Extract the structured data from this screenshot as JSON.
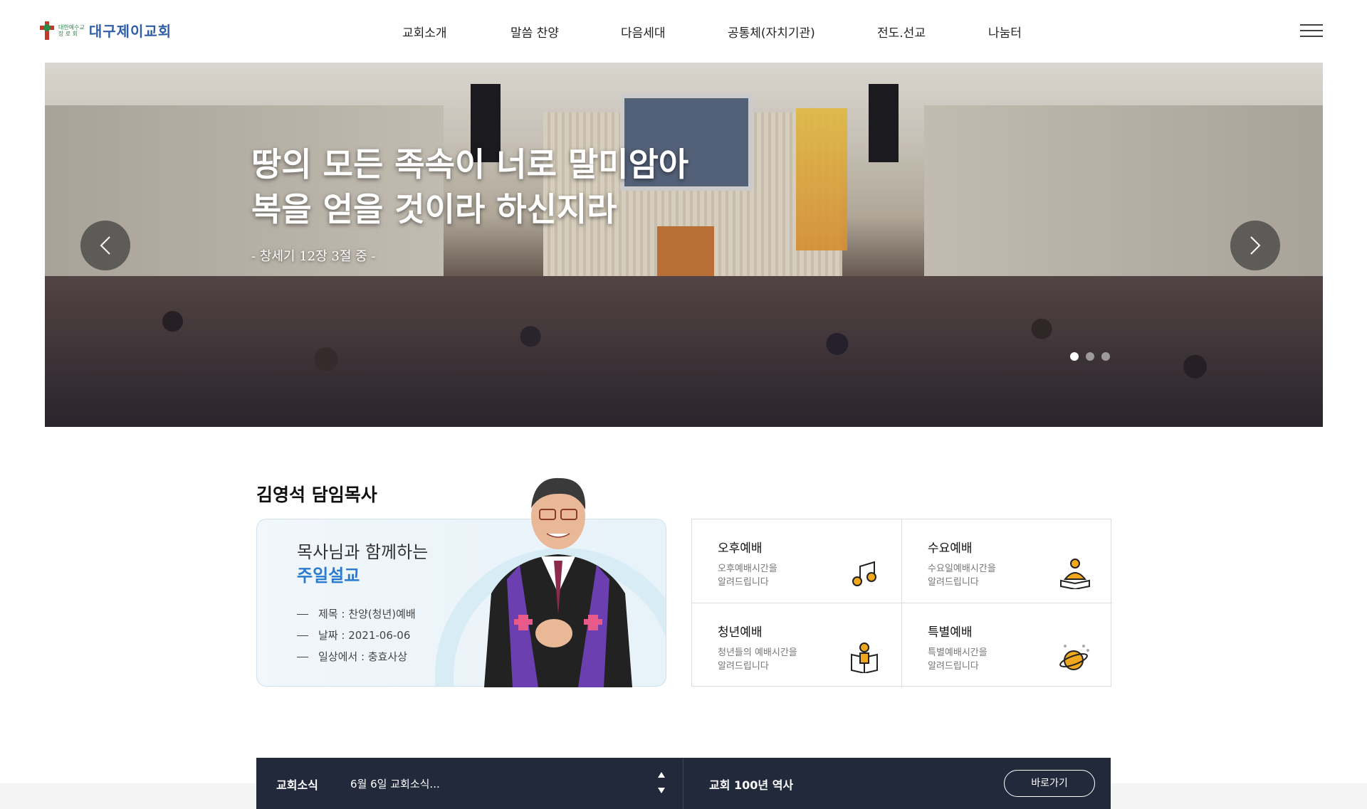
{
  "header": {
    "logo_small_1": "대한예수교",
    "logo_small_2": "장 로 회",
    "logo_name": "대구제이교회",
    "nav": [
      "교회소개",
      "말씀 찬양",
      "다음세대",
      "공통체(자치기관)",
      "전도.선교",
      "나눔터"
    ]
  },
  "hero": {
    "title_line1": "땅의 모든 족속이 너로 말미암아",
    "title_line2": "복을 얻을 것이라 하신지라",
    "subtitle": "- 창세기 12장 3절 중 -",
    "slide_count": 3,
    "active_slide": 1
  },
  "pastor": {
    "title": "김영석 담임목사",
    "sermon_heading": "목사님과 함께하는",
    "sermon_accent": "주일설교",
    "items": [
      "제목 : 찬양(청년)예배",
      "날짜 : 2021-06-06",
      "일상에서 : 충효사상"
    ]
  },
  "worship": [
    {
      "title": "오후예배",
      "desc_1": "오후예배시간을",
      "desc_2": "알려드립니다",
      "icon": "music-note-icon"
    },
    {
      "title": "수요예배",
      "desc_1": "수요일예배시간을",
      "desc_2": "알려드립니다",
      "icon": "reading-person-icon"
    },
    {
      "title": "청년예배",
      "desc_1": "청년들의 예배시간을",
      "desc_2": "알려드립니다",
      "icon": "open-book-person-icon"
    },
    {
      "title": "특별예배",
      "desc_1": "특별예배시간을",
      "desc_2": "알려드립니다",
      "icon": "planet-icon"
    }
  ],
  "news": {
    "label": "교회소식",
    "text": "6월 6일 교회소식...",
    "history_label": "교회 100년 역사",
    "go_button": "바로가기"
  },
  "colors": {
    "accent_blue": "#2a7bd0",
    "navy_bar": "#22293a",
    "icon_orange": "#f2a81d"
  }
}
